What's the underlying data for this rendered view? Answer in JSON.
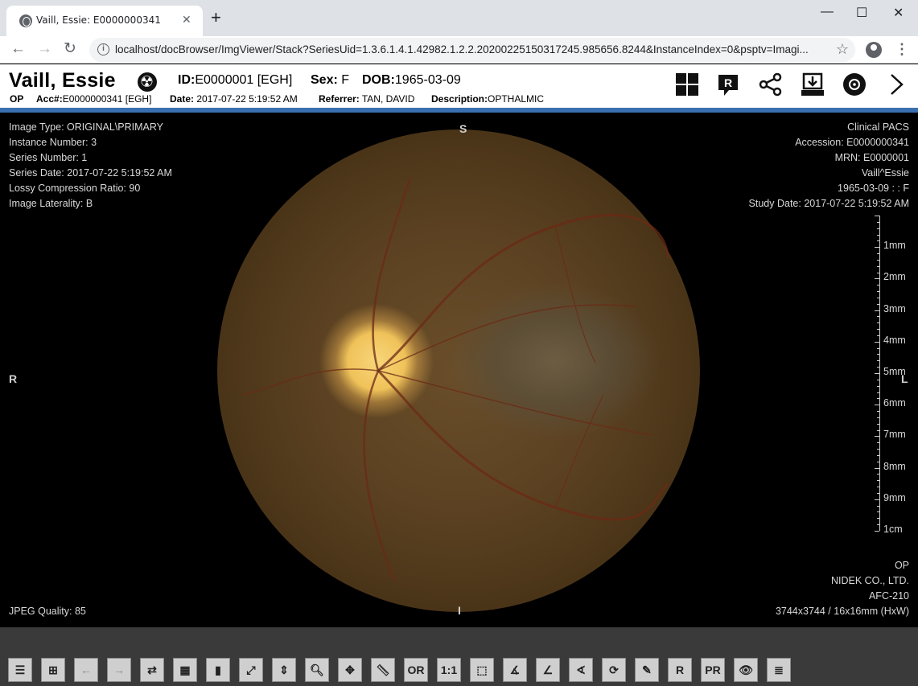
{
  "browser": {
    "tab_title": "Vaill, Essie: E0000000341",
    "tab_close": "✕",
    "new_tab": "+",
    "minimize": "—",
    "maximize": "☐",
    "close": "✕",
    "back": "←",
    "forward": "→",
    "reload": "↻",
    "url": "localhost/docBrowser/ImgViewer/Stack?SeriesUid=1.3.6.1.4.1.42982.1.2.2.20200225150317245.985656.8244&InstanceIndex=0&psptv=Imagi...",
    "star": "☆",
    "menu": "⋮"
  },
  "header": {
    "patient_name": "Vaill, Essie",
    "id_label": "ID:",
    "id_value": "E0000001 [EGH]",
    "sex_label": "Sex:",
    "sex_value": "F",
    "dob_label": "DOB:",
    "dob_value": "1965-03-09",
    "modality": "OP",
    "acc_label": "Acc#:",
    "acc_value": "E0000000341 [EGH]",
    "date_label": "Date:",
    "date_value": "2017-07-22 5:19:52 AM",
    "referrer_label": "Referrer:",
    "referrer_value": "TAN, DAVID",
    "description_label": "Description:",
    "description_value": "OPTHALMIC",
    "icons": [
      "layout-grid-icon",
      "report-icon",
      "share-icon",
      "download-icon",
      "burn-disc-icon",
      "next-icon"
    ]
  },
  "overlay": {
    "top_left": [
      "Image Type: ORIGINAL\\PRIMARY",
      "Instance Number: 3",
      "Series Number: 1",
      "Series Date: 2017-07-22 5:19:52 AM",
      "Lossy Compression Ratio: 90",
      "Image Laterality: B"
    ],
    "top_right": [
      "Clinical PACS",
      "Accession: E0000000341",
      "MRN: E0000001",
      "Vaill^Essie",
      "1965-03-09 : : F",
      "Study Date: 2017-07-22 5:19:52 AM"
    ],
    "bottom_left": "JPEG Quality: 85",
    "bottom_right": [
      "OP",
      "NIDEK CO., LTD.",
      "AFC-210",
      "3744x3744 / 16x16mm (HxW)"
    ],
    "orient_top": "S",
    "orient_bottom": "I",
    "orient_left": "R",
    "orient_right": "L",
    "ruler_labels": [
      "1mm",
      "2mm",
      "3mm",
      "4mm",
      "5mm",
      "6mm",
      "7mm",
      "8mm",
      "9mm",
      "1cm"
    ]
  },
  "toolbar_buttons": [
    {
      "name": "series-list-button",
      "label": "☰",
      "dim": false
    },
    {
      "name": "layout-button",
      "label": "⊞",
      "dim": false
    },
    {
      "name": "prev-image-button",
      "label": "←",
      "dim": true
    },
    {
      "name": "next-image-button",
      "label": "→",
      "dim": true
    },
    {
      "name": "swap-series-button",
      "label": "⇄",
      "dim": false
    },
    {
      "name": "grid-button",
      "label": "▦",
      "dim": false
    },
    {
      "name": "split-button",
      "label": "▮",
      "dim": false
    },
    {
      "name": "fit-button",
      "label": "⤢",
      "dim": false
    },
    {
      "name": "stack-scroll-button",
      "label": "⇕",
      "dim": false
    },
    {
      "name": "zoom-button",
      "label": "🔍︎",
      "dim": false
    },
    {
      "name": "pan-button",
      "label": "✥",
      "dim": false
    },
    {
      "name": "measure-button",
      "label": "📏︎",
      "dim": false
    },
    {
      "name": "roi-button",
      "label": "OR",
      "dim": false
    },
    {
      "name": "actual-size-button",
      "label": "1:1",
      "dim": false
    },
    {
      "name": "crop-button",
      "label": "⬚",
      "dim": false
    },
    {
      "name": "angle-button",
      "label": "∡",
      "dim": false
    },
    {
      "name": "cobb-angle-button",
      "label": "∠",
      "dim": false
    },
    {
      "name": "arrow-angle-button",
      "label": "∢",
      "dim": false
    },
    {
      "name": "reset-button",
      "label": "⟳",
      "dim": false
    },
    {
      "name": "annotation-button",
      "label": "✎",
      "dim": false
    },
    {
      "name": "report-tool-button",
      "label": "R",
      "dim": false
    },
    {
      "name": "pr-button",
      "label": "PR",
      "dim": false
    },
    {
      "name": "view-button",
      "label": "👁︎",
      "dim": false
    },
    {
      "name": "more-button",
      "label": "≣",
      "dim": false
    }
  ]
}
